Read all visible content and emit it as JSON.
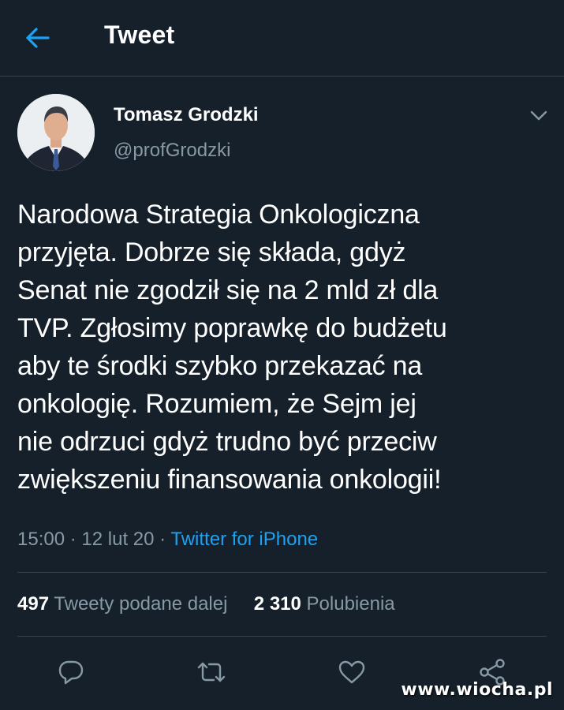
{
  "header": {
    "title": "Tweet"
  },
  "author": {
    "name": "Tomasz Grodzki",
    "handle": "@profGrodzki"
  },
  "tweet": {
    "text": "Narodowa Strategia Onkologiczna\nprzyjęta. Dobrze się składa, gdyż\nSenat nie zgodził się na 2 mld zł dla\nTVP. Zgłosimy poprawkę do budżetu\naby te środki szybko przekazać na\nonkologię. Rozumiem, że Sejm jej\nnie odrzuci gdyż trudno być przeciw\nzwiększeniu finansowania onkologii!",
    "time": "15:00",
    "date": "12 lut 20",
    "separator": "·",
    "source": "Twitter for iPhone"
  },
  "stats": {
    "retweets_count": "497",
    "retweets_label": "Tweety podane dalej",
    "likes_count": "2 310",
    "likes_label": "Polubienia"
  },
  "icons": {
    "back": "arrow-left-icon",
    "menu": "chevron-down-icon",
    "reply": "reply-icon",
    "retweet": "retweet-icon",
    "like": "heart-icon",
    "share": "share-icon"
  },
  "colors": {
    "background": "#15202b",
    "accent": "#1da1f2",
    "secondary_text": "#8899a6",
    "divider": "#38444d"
  },
  "watermark": "www.wiocha.pl"
}
